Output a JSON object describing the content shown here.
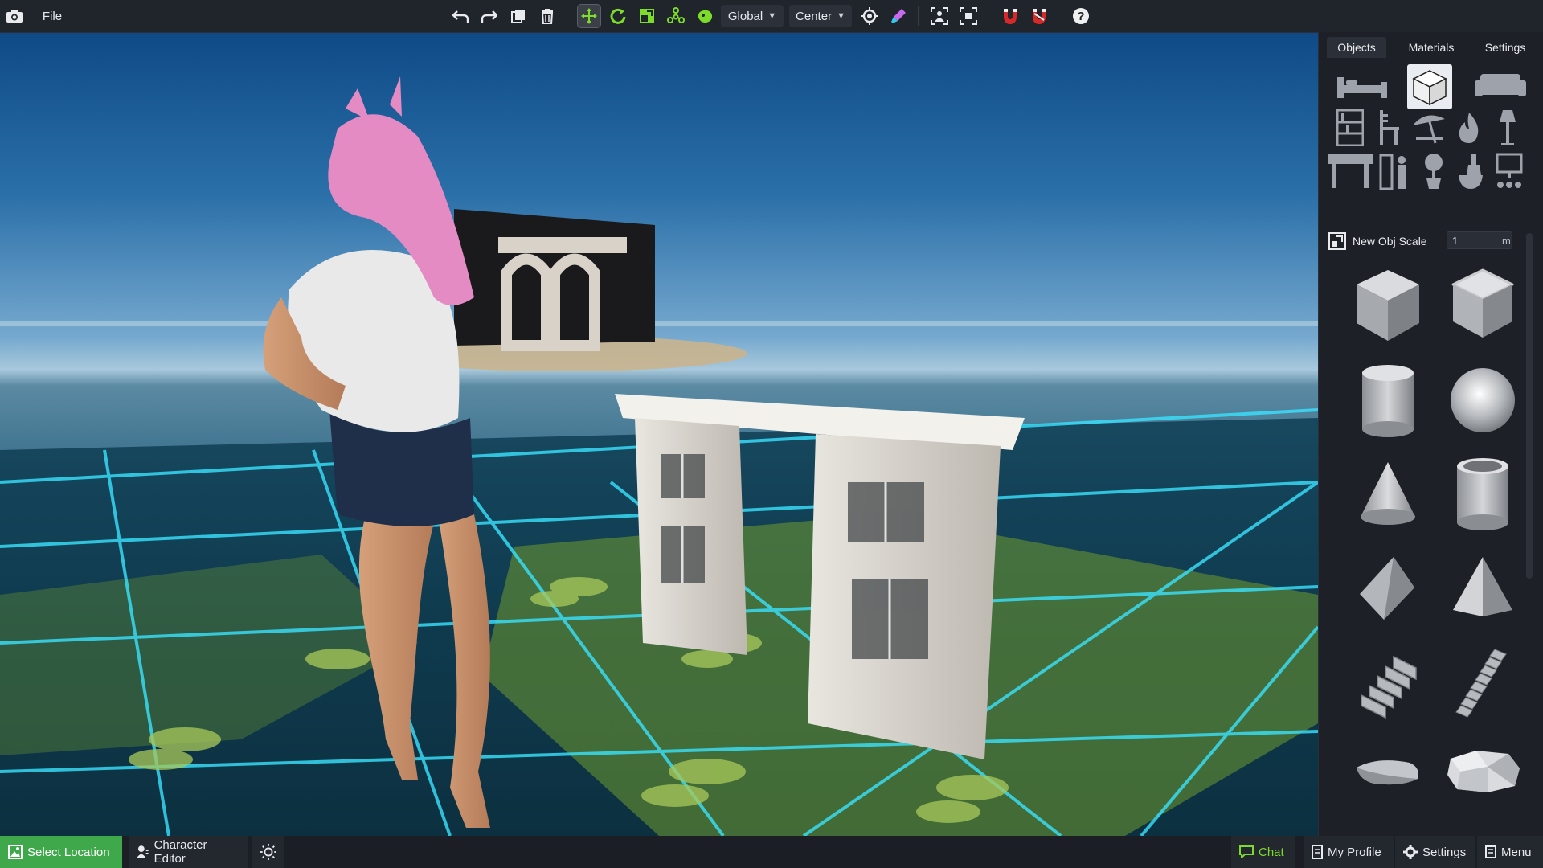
{
  "toolbar": {
    "file_label": "File",
    "space_mode": "Global",
    "pivot_mode": "Center",
    "icons": [
      "camera-icon",
      "undo-icon",
      "redo-icon",
      "duplicate-icon",
      "delete-icon",
      "move-icon",
      "rotate-icon",
      "scale-icon",
      "multi-select-icon",
      "paint-icon",
      "snap-icon",
      "eyedropper-icon",
      "focus-icon",
      "frame-icon",
      "magnet-icon",
      "magnet-off-icon",
      "help-icon"
    ]
  },
  "panel": {
    "tabs": [
      "Objects",
      "Materials",
      "Settings"
    ],
    "active_tab": "Objects",
    "categories": [
      "bed",
      "primitives",
      "sofa",
      "shelf",
      "chair",
      "umbrella",
      "fire",
      "lamp",
      "table",
      "wardrobe",
      "plant",
      "kitchen",
      "electronics"
    ],
    "new_obj_scale_label": "New Obj Scale",
    "new_obj_scale_value": "1",
    "new_obj_scale_unit": "m",
    "shapes": [
      "cube",
      "rounded-cube",
      "cylinder",
      "sphere",
      "cone",
      "tube",
      "wedge",
      "pyramid",
      "stairs",
      "spiral-stairs",
      "flat-stone",
      "rock"
    ]
  },
  "bottom": {
    "select_location": "Select Location",
    "character_editor": "Character Editor",
    "chat": "Chat",
    "my_profile": "My Profile",
    "settings": "Settings",
    "menu": "Menu"
  },
  "colors": {
    "accent_green": "#3ea84a",
    "toolbar_green": "#7ddc2a",
    "magnet_red": "#d62a2a",
    "grid_cyan": "#39e3ff"
  }
}
